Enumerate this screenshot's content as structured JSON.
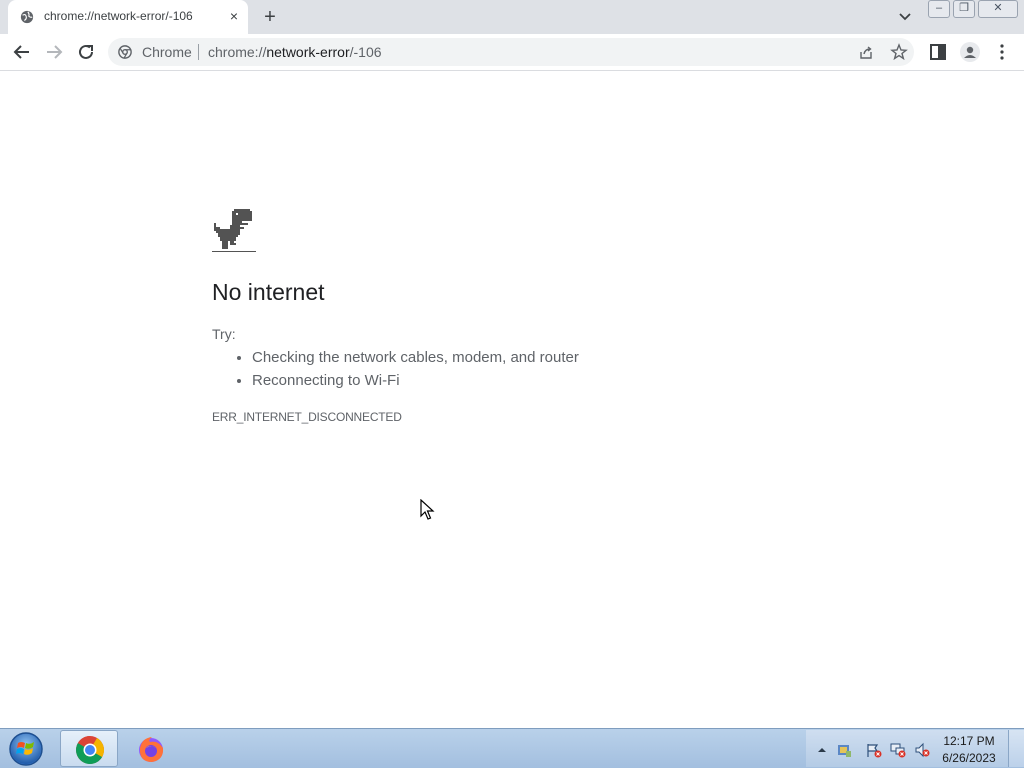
{
  "tab": {
    "title": "chrome://network-error/-106",
    "close_icon": "×",
    "favicon": "globe-icon"
  },
  "newtab": {
    "label": "+"
  },
  "window_controls": {
    "minimize": "–",
    "restore": "❐",
    "close": "✕"
  },
  "omnibox": {
    "chip": "Chrome",
    "url_scheme": "chrome://",
    "url_host": "network-error",
    "url_path": "/-106"
  },
  "page": {
    "heading": "No internet",
    "try_label": "Try:",
    "suggestions": [
      "Checking the network cables, modem, and router",
      "Reconnecting to Wi-Fi"
    ],
    "error_code": "ERR_INTERNET_DISCONNECTED"
  },
  "taskbar": {
    "apps": [
      "chrome-icon",
      "firefox-icon"
    ],
    "time": "12:17 PM",
    "date": "6/26/2023"
  },
  "colors": {
    "tabstrip": "#dee1e6",
    "omnibox": "#f1f3f4",
    "text_primary": "#202124",
    "text_secondary": "#5f6368"
  }
}
